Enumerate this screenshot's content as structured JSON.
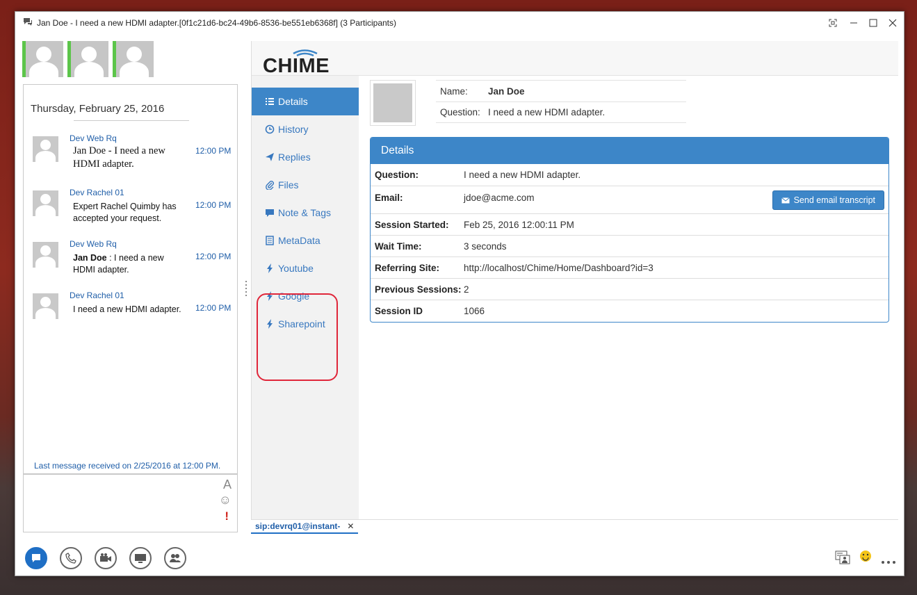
{
  "window": {
    "title": "Jan Doe - I need a new HDMI adapter.[0f1c21d6-bc24-49b6-8536-be551eb6368f] (3 Participants)"
  },
  "conversation": {
    "date": "Thursday, February 25, 2016",
    "messages": [
      {
        "sender": "Dev Web Rq",
        "time": "12:00 PM",
        "text": "Jan Doe - I need a new HDMI adapter."
      },
      {
        "sender": "Dev Rachel 01",
        "time": "12:00 PM",
        "text": "Expert Rachel Quimby has accepted your request."
      },
      {
        "sender": "Dev Web Rq",
        "time": "12:00 PM",
        "bold": "Jan Doe",
        "text": " : I need a new HDMI adapter."
      },
      {
        "sender": "Dev Rachel 01",
        "time": "12:00 PM",
        "text": "I need a new HDMI adapter."
      }
    ],
    "last_message": "Last message received on 2/25/2016 at 12:00 PM.",
    "input_icons": {
      "font": "A",
      "emoji": "☺",
      "important": "!"
    }
  },
  "brand": {
    "logo_text": "CHIME",
    "accent": "#3d86c8"
  },
  "nav": {
    "items": [
      {
        "label": "Details",
        "icon": "list-icon"
      },
      {
        "label": "History",
        "icon": "history-icon"
      },
      {
        "label": "Replies",
        "icon": "send-icon"
      },
      {
        "label": "Files",
        "icon": "paperclip-icon"
      },
      {
        "label": "Note & Tags",
        "icon": "comment-icon"
      },
      {
        "label": "MetaData",
        "icon": "document-icon"
      },
      {
        "label": "Youtube",
        "icon": "bolt-icon"
      },
      {
        "label": "Google",
        "icon": "bolt-icon"
      },
      {
        "label": "Sharepoint",
        "icon": "bolt-icon"
      }
    ]
  },
  "user": {
    "name_label": "Name:",
    "name": "Jan Doe",
    "question_label": "Question:",
    "question": "I need a new HDMI adapter."
  },
  "details": {
    "title": "Details",
    "rows": [
      {
        "key": "Question:",
        "value": "I need a new HDMI adapter."
      },
      {
        "key": "Email:",
        "value": "jdoe@acme.com"
      },
      {
        "key": "Session Started:",
        "value": "Feb 25, 2016 12:00:11 PM"
      },
      {
        "key": "Wait Time:",
        "value": "3 seconds"
      },
      {
        "key": "Referring Site:",
        "value": "http://localhost/Chime/Home/Dashboard?id=3"
      },
      {
        "key": "Previous Sessions:",
        "value": "2"
      },
      {
        "key": "Session ID",
        "value": "1066"
      }
    ],
    "send_button": "Send email transcript"
  },
  "tab": {
    "label": "sip:devrq01@instant-",
    "close": "✕"
  }
}
